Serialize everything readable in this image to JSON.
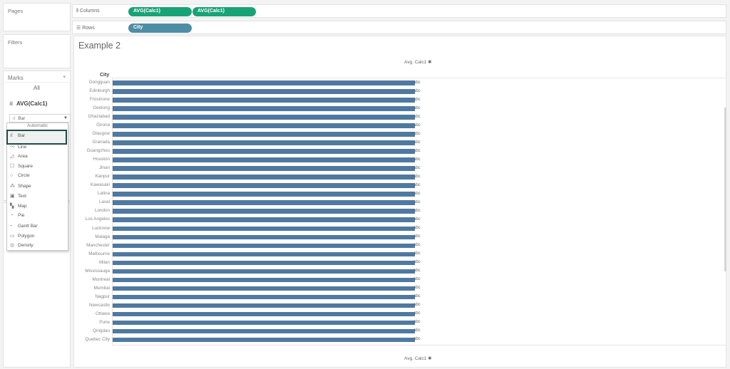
{
  "left_panel": {
    "pages_title": "Pages",
    "filters_title": "Filters",
    "marks_title": "Marks",
    "marks_all": "All",
    "marks_calc": "AVG(Calc1)",
    "mark_type_selected": "Bar",
    "mark_type_menu": [
      {
        "label": "Automatic",
        "icon": "none"
      },
      {
        "label": "Bar",
        "icon": "bar-chart-icon"
      },
      {
        "label": "Line",
        "icon": "line-chart-icon"
      },
      {
        "label": "Area",
        "icon": "area-chart-icon"
      },
      {
        "label": "Square",
        "icon": "square-icon"
      },
      {
        "label": "Circle",
        "icon": "circle-icon"
      },
      {
        "label": "Shape",
        "icon": "shape-icon"
      },
      {
        "label": "Text",
        "icon": "text-icon"
      },
      {
        "label": "Map",
        "icon": "map-icon"
      },
      {
        "label": "Pie",
        "icon": "pie-icon"
      },
      {
        "label": "Gantt Bar",
        "icon": "gantt-bar-icon"
      },
      {
        "label": "Polygon",
        "icon": "polygon-icon"
      },
      {
        "label": "Density",
        "icon": "density-icon"
      }
    ]
  },
  "shelves": {
    "columns_label": "Columns",
    "rows_label": "Rows",
    "columns_pills": [
      "AVG(Calc1)",
      "AVG(Calc1)"
    ],
    "rows_pills": [
      "City"
    ]
  },
  "view": {
    "title": "Example 2",
    "axis_title_top": "Avg. Calc1",
    "axis_title_bottom": "Avg. Calc1",
    "row_header": "City"
  },
  "colors": {
    "bar": "#4f79a1",
    "pill_measure": "#18a377",
    "pill_dimension": "#4e8ea4",
    "menu_highlight_border": "#1f4a48"
  },
  "chart_data": {
    "type": "bar",
    "orientation": "horizontal",
    "categories": [
      "Dongguan",
      "Edinburgh",
      "Frosinone",
      "Geelong",
      "Ghaziabad",
      "Girona",
      "Glasgow",
      "Granada",
      "Guangzhou",
      "Houston",
      "Jinan",
      "Kanpur",
      "Kawasaki",
      "Latina",
      "Laval",
      "London",
      "Los Angeles",
      "Lucknow",
      "Malaga",
      "Manchester",
      "Melbourne",
      "Milan",
      "Mississauga",
      "Montreal",
      "Mumbai",
      "Nagpur",
      "Newcastle",
      "Ottawa",
      "Pune",
      "Qingdao",
      "Quebec City"
    ],
    "values": [
      1,
      1,
      1,
      1,
      1,
      1,
      1,
      1,
      1,
      1,
      1,
      1,
      1,
      1,
      1,
      1,
      1,
      1,
      1,
      1,
      1,
      1,
      1,
      1,
      1,
      1,
      1,
      1,
      1,
      1,
      1
    ],
    "data_label": "abc",
    "xlabel": "Avg. Calc1",
    "ylabel": "City"
  }
}
